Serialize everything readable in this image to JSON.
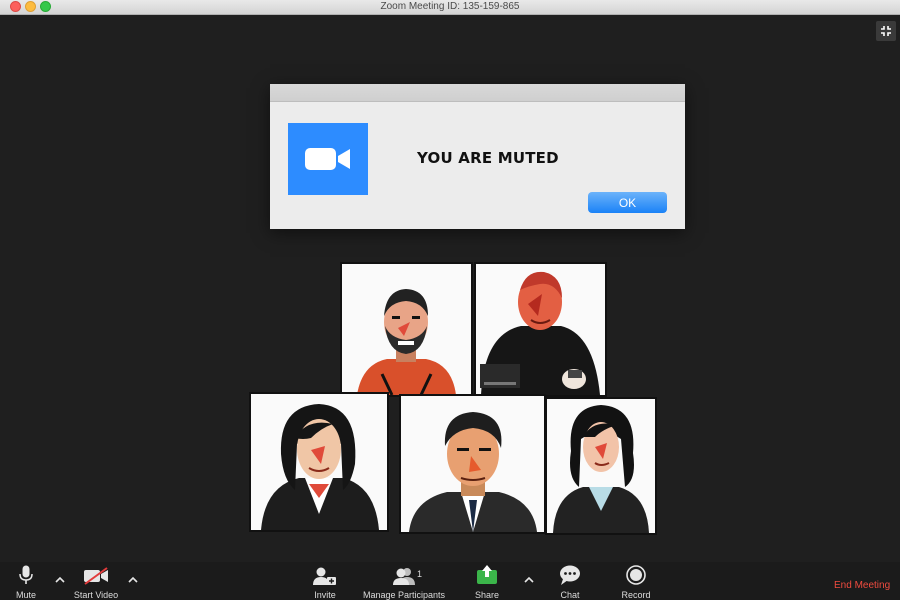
{
  "window": {
    "title": "Zoom Meeting ID: 135-159-865"
  },
  "dialog": {
    "message": "YOU ARE MUTED",
    "ok_label": "OK",
    "logo_color": "#2d8cff"
  },
  "gallery": {
    "participants": [
      {
        "shirt": "#d9502b",
        "hair": "#222222",
        "skin": "#e8a487"
      },
      {
        "shirt": "#161616",
        "hair": "#d7493a",
        "skin": "#e35f43"
      },
      {
        "shirt": "#1d1d1d",
        "hair": "#151515",
        "skin": "#f0c6a6"
      },
      {
        "shirt": "#2a2a2a",
        "hair": "#1e1e1e",
        "skin": "#e8a071"
      },
      {
        "shirt": "#222222",
        "hair": "#121212",
        "skin": "#f2c3a8"
      }
    ]
  },
  "toolbar": {
    "mute_label": "Mute",
    "start_video_label": "Start Video",
    "invite_label": "Invite",
    "manage_participants_label": "Manage Participants",
    "participant_count": "1",
    "share_label": "Share",
    "chat_label": "Chat",
    "record_label": "Record",
    "end_meeting_label": "End Meeting",
    "end_color": "#f04b3f",
    "share_color": "#3bb54a"
  }
}
